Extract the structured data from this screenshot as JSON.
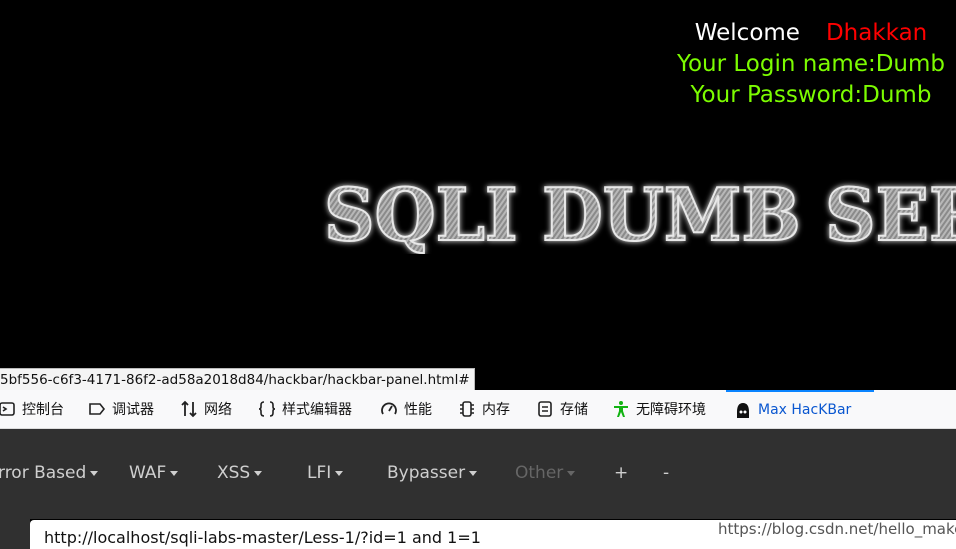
{
  "page": {
    "welcome_label": "Welcome",
    "username": "Dhakkan",
    "login_line": "Your Login name:Dumb",
    "password_line": "Your Password:Dumb",
    "banner_text": "SQLI DUMB SERIES"
  },
  "status_url": "5bf556-c6f3-4171-86f2-ad58a2018d84/hackbar/hackbar-panel.html#",
  "devtools": {
    "tabs": [
      {
        "label": "控制台",
        "icon": "console-icon"
      },
      {
        "label": "调试器",
        "icon": "debugger-icon"
      },
      {
        "label": "网络",
        "icon": "network-icon"
      },
      {
        "label": "样式编辑器",
        "icon": "style-editor-icon"
      },
      {
        "label": "性能",
        "icon": "performance-icon"
      },
      {
        "label": "内存",
        "icon": "memory-icon"
      },
      {
        "label": "存储",
        "icon": "storage-icon"
      },
      {
        "label": "无障碍环境",
        "icon": "accessibility-icon"
      },
      {
        "label": "Max HacKBar",
        "icon": "hackbar-icon",
        "active": true
      }
    ]
  },
  "hackbar": {
    "menus": [
      {
        "label": "rror Based",
        "dropdown": true
      },
      {
        "label": "WAF",
        "dropdown": true
      },
      {
        "label": "XSS",
        "dropdown": true
      },
      {
        "label": "LFI",
        "dropdown": true
      },
      {
        "label": "Bypasser",
        "dropdown": true
      },
      {
        "label": "Other",
        "dropdown": true,
        "disabled": true
      },
      {
        "label": "+",
        "dropdown": false
      },
      {
        "label": "-",
        "dropdown": false
      }
    ],
    "url_value": "http://localhost/sqli-labs-master/Less-1/?id=1 and 1=1"
  },
  "watermark": "https://blog.csdn.net/hello_make",
  "colors": {
    "background": "#000000",
    "username": "#ff0000",
    "credentials": "#7CFC00",
    "active_tab": "#0a57d0",
    "toolbar": "#303030"
  }
}
